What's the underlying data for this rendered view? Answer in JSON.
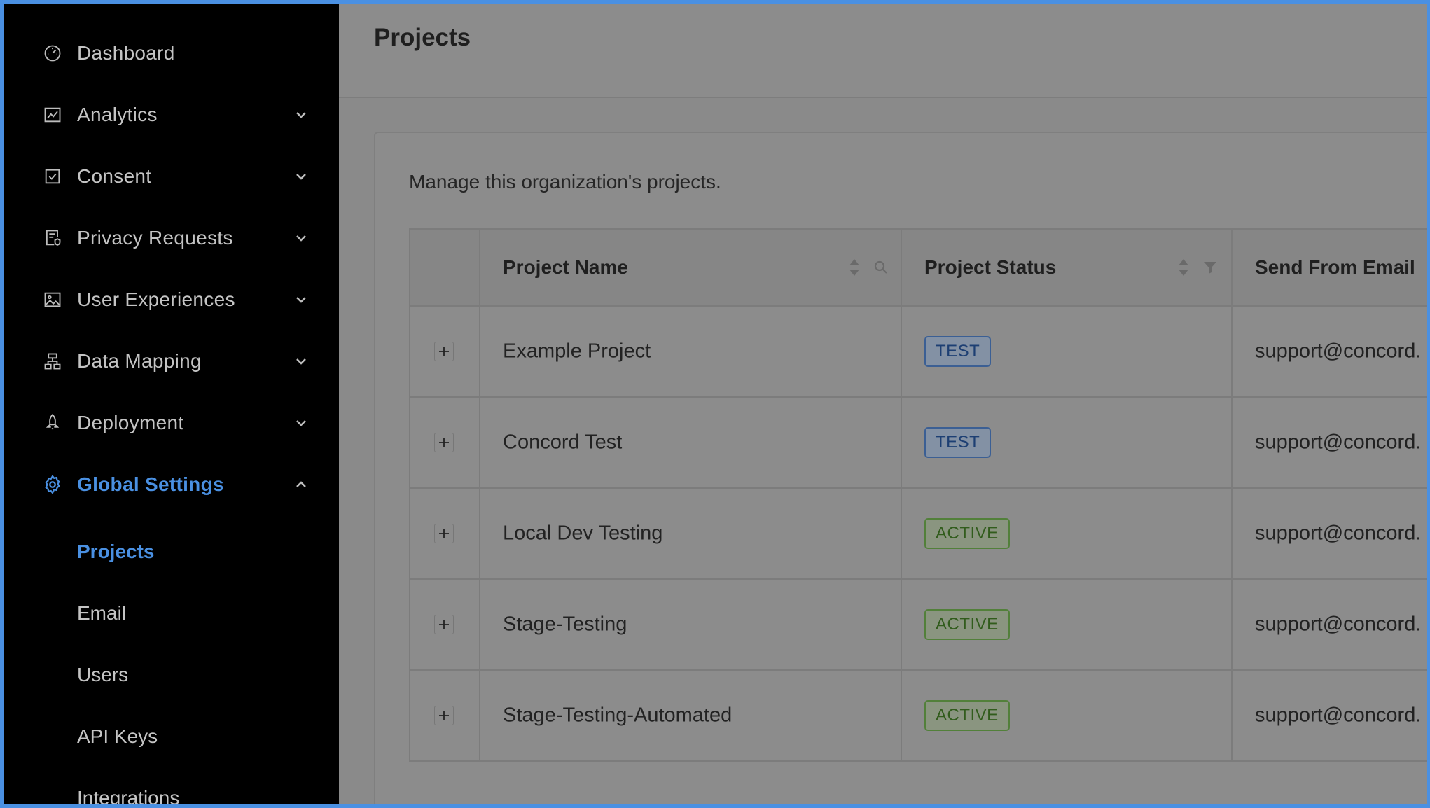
{
  "sidebar": {
    "items": [
      {
        "label": "Dashboard",
        "icon": "dashboard-icon"
      },
      {
        "label": "Analytics",
        "icon": "line-chart-icon"
      },
      {
        "label": "Consent",
        "icon": "checkbox-icon"
      },
      {
        "label": "Privacy Requests",
        "icon": "document-shield-icon"
      },
      {
        "label": "User Experiences",
        "icon": "image-icon"
      },
      {
        "label": "Data Mapping",
        "icon": "sitemap-icon"
      },
      {
        "label": "Deployment",
        "icon": "rocket-icon"
      },
      {
        "label": "Global Settings",
        "icon": "gear-icon"
      }
    ],
    "sub_items": [
      "Projects",
      "Email",
      "Users",
      "API Keys",
      "Integrations"
    ],
    "active_color": "#4a90e2"
  },
  "header": {
    "title": "Projects"
  },
  "main": {
    "description": "Manage this organization's projects.",
    "columns": [
      "Project Name",
      "Project Status",
      "Send From Email"
    ],
    "rows": [
      {
        "name": "Example Project",
        "status": "TEST",
        "email": "support@concord."
      },
      {
        "name": "Concord Test",
        "status": "TEST",
        "email": "support@concord."
      },
      {
        "name": "Local Dev Testing",
        "status": "ACTIVE",
        "email": "support@concord."
      },
      {
        "name": "Stage-Testing",
        "status": "ACTIVE",
        "email": "support@concord."
      },
      {
        "name": "Stage-Testing-Automated",
        "status": "ACTIVE",
        "email": "support@concord."
      }
    ]
  }
}
